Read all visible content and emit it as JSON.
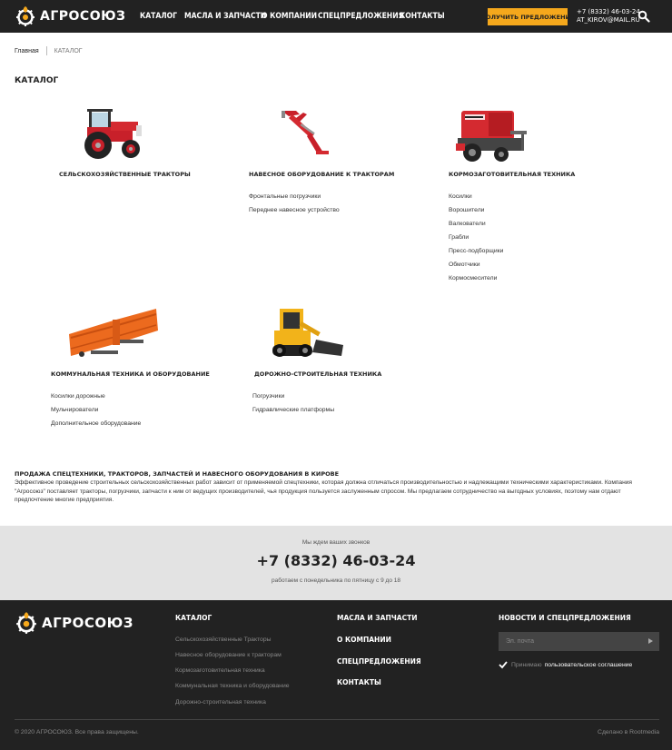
{
  "header": {
    "logo_text": "АГРОСОЮЗ",
    "nav": [
      "КАТАЛОГ",
      "МАСЛА И ЗАПЧАСТИ",
      "О КОМПАНИИ",
      "СПЕЦПРЕДЛОЖЕНИЯ",
      "КОНТАКТЫ"
    ],
    "cta_label": "ПОЛУЧИТЬ ПРЕДЛОЖЕНИЕ",
    "phone": "+7 (8332) 46-03-24",
    "email": "AT_KIROV@MAIL.RU",
    "search_icon": "search-icon"
  },
  "breadcrumb": {
    "home": "Главная",
    "current": "КАТАЛОГ"
  },
  "page_title": "КАТАЛОГ",
  "catalog": [
    {
      "title": "СЕЛЬСКОХОЗЯЙСТВЕННЫЕ ТРАКТОРЫ",
      "items": [],
      "image": "tractor-image"
    },
    {
      "title": "НАВЕСНОЕ ОБОРУДОВАНИЕ К ТРАКТОРАМ",
      "items": [
        "Фронтальные погрузчики",
        "Переднее навесное устройство"
      ],
      "image": "front-loader-image"
    },
    {
      "title": "КОРМОЗАГОТОВИТЕЛЬНАЯ ТЕХНИКА",
      "items": [
        "Косилки",
        "Ворошители",
        "Валкователи",
        "Грабли",
        "Пресс-подборщики",
        "Обмотчики",
        "Кормосмесители"
      ],
      "image": "baler-image"
    },
    {
      "title": "КОММУНАЛЬНАЯ ТЕХНИКА И ОБОРУДОВАНИЕ",
      "items": [
        "Косилки дорожные",
        "Мульчирователи",
        "Дополнительное оборудование"
      ],
      "image": "snow-plow-image"
    },
    {
      "title": "ДОРОЖНО-СТРОИТЕЛЬНАЯ ТЕХНИКА",
      "items": [
        "Погрузчики",
        "Гидравлические платформы"
      ],
      "image": "skid-steer-image"
    }
  ],
  "seo": {
    "heading": "ПРОДАЖА СПЕЦТЕХНИКИ, ТРАКТОРОВ, ЗАПЧАСТЕЙ И НАВЕСНОГО ОБОРУДОВАНИЯ В КИРОВЕ",
    "text": "Эффективное проведение строительных сельскохозяйственных работ зависит от применяемой спецтехники, которая должна отличаться производительностью и надлежащими техническими характеристиками. Компания \"Агросоюз\" поставляет тракторы, погрузчики, запчасти к ним от ведущих производителей, чья продукция пользуется заслуженным спросом. Мы предлагаем сотрудничество на выгодных условиях, поэтому нам отдают предпочтение многие предприятия."
  },
  "callback": {
    "small": "Мы ждем ваших звонков",
    "phone": "+7 (8332) 46-03-24",
    "hours": "работаем с понедельника по пятницу с 9 до 18"
  },
  "footer": {
    "logo_text": "АГРОСОЮЗ",
    "catalog_heading": "КАТАЛОГ",
    "catalog_links": [
      "Сельскохозяйственные Тракторы",
      "Навесное оборудование к тракторам",
      "Кормозаготовительная техника",
      "Коммунальная техника и оборудование",
      "Дорожно-строительная техника"
    ],
    "col2": [
      "МАСЛА И ЗАПЧАСТИ",
      "О КОМПАНИИ",
      "СПЕЦПРЕДЛОЖЕНИЯ",
      "КОНТАКТЫ"
    ],
    "news_heading": "НОВОСТИ И СПЕЦПРЕДЛОЖЕНИЯ",
    "email_placeholder": "Эл. почта",
    "agree_text": "Принимаю",
    "agree_link": "пользовательское соглашение",
    "copyright": "© 2020 АГРОСОЮЗ. Все права защищены.",
    "made_by": "Сделано в Rootmedia"
  },
  "colors": {
    "accent": "#f5a81c",
    "dark": "#222222",
    "callback_bg": "#e3e3e3"
  }
}
